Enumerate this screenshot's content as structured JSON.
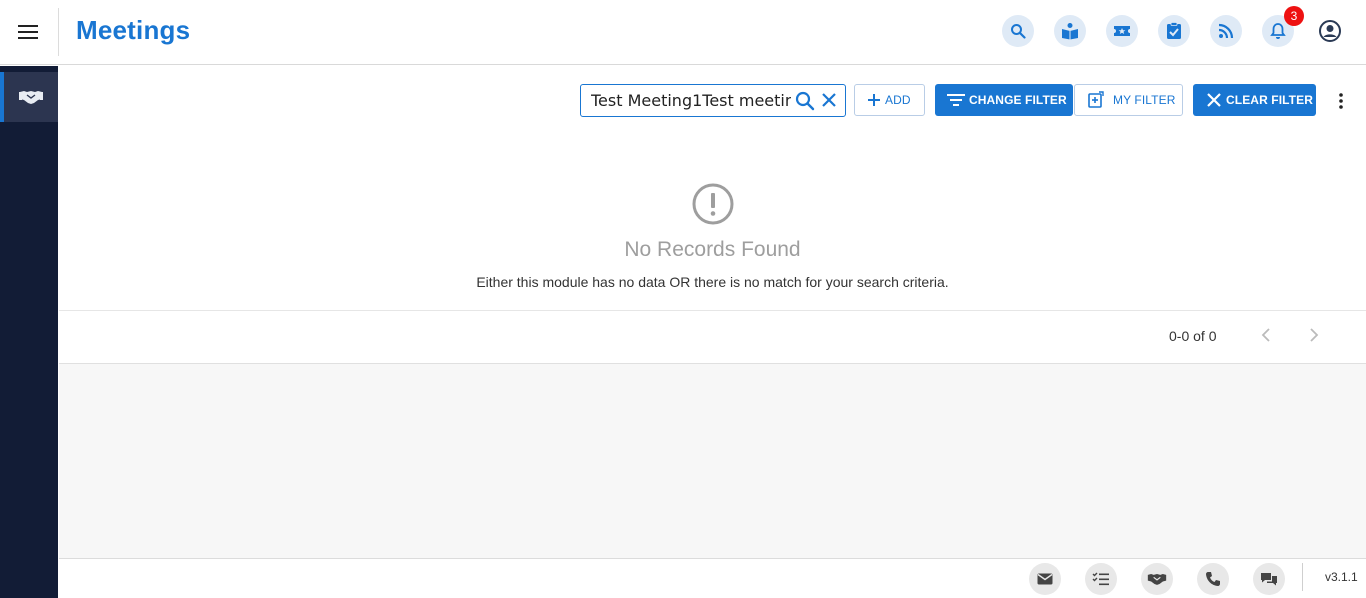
{
  "header": {
    "title": "Meetings",
    "notification_count": "3",
    "icons": [
      "search-icon",
      "book-icon",
      "ticket-icon",
      "task-icon",
      "rss-icon",
      "bell-icon",
      "account-icon"
    ]
  },
  "sidebar": {
    "items": [
      {
        "icon": "handshake-icon",
        "active": true
      }
    ]
  },
  "toolbar": {
    "search_value": "Test Meeting1Test meetin",
    "add_label": "ADD",
    "change_filter_label": "CHANGE FILTER",
    "my_filter_label": "MY FILTER",
    "clear_filter_label": "CLEAR FILTER"
  },
  "empty_state": {
    "title": "No Records Found",
    "message": "Either this module has no data OR there is no match for your search criteria."
  },
  "pagination": {
    "range": "0-0 of 0"
  },
  "footer": {
    "icons": [
      "email-icon",
      "checklist-icon",
      "handshake-icon",
      "phone-icon",
      "chat-icon"
    ],
    "version": "v3.1.1"
  },
  "colors": {
    "accent": "#1976d2",
    "sidebar": "#121c36",
    "badge": "#ee1111"
  }
}
